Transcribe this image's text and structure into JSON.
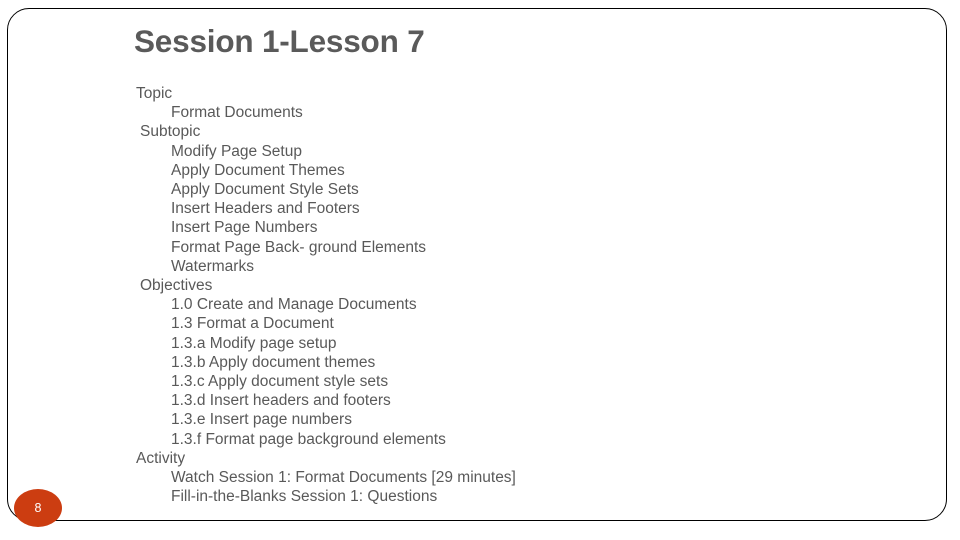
{
  "slide": {
    "title": "Session 1-Lesson 7",
    "page_number": "8",
    "colors": {
      "title_text": "#5a5a5a",
      "body_text": "#595959",
      "frame_border": "#000000",
      "badge_fill": "#cc3d11",
      "badge_text": "#ffffff",
      "background": "#ffffff"
    },
    "outline": [
      {
        "level": "a",
        "text": "Topic"
      },
      {
        "level": "c",
        "text": "Format Documents"
      },
      {
        "level": "b",
        "text": "Subtopic"
      },
      {
        "level": "c",
        "text": "Modify Page Setup"
      },
      {
        "level": "c",
        "text": "Apply Document Themes"
      },
      {
        "level": "c",
        "text": "Apply Document Style Sets"
      },
      {
        "level": "c",
        "text": "Insert Headers and Footers"
      },
      {
        "level": "c",
        "text": "Insert Page Numbers"
      },
      {
        "level": "c",
        "text": "Format Page Back- ground Elements"
      },
      {
        "level": "c",
        "text": "Watermarks"
      },
      {
        "level": "b",
        "text": "Objectives"
      },
      {
        "level": "c",
        "text": "1.0 Create and Manage Documents"
      },
      {
        "level": "c",
        "text": "1.3 Format a Document"
      },
      {
        "level": "c",
        "text": "1.3.a Modify page setup"
      },
      {
        "level": "c",
        "text": "1.3.b Apply document themes"
      },
      {
        "level": "c",
        "text": "1.3.c Apply document style sets"
      },
      {
        "level": "c",
        "text": "1.3.d Insert headers and footers"
      },
      {
        "level": "c",
        "text": "1.3.e Insert page numbers"
      },
      {
        "level": "c",
        "text": "1.3.f Format page background elements"
      },
      {
        "level": "a",
        "text": "Activity"
      },
      {
        "level": "c",
        "text": "Watch Session 1: Format Documents [29 minutes]"
      },
      {
        "level": "c",
        "text": "Fill-in-the-Blanks Session 1: Questions"
      }
    ]
  }
}
